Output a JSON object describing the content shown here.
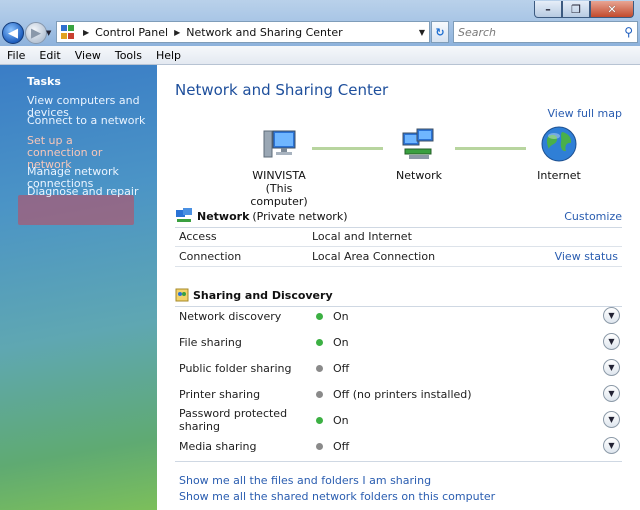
{
  "window": {
    "breadcrumbs": [
      "Control Panel",
      "Network and Sharing Center"
    ],
    "search_placeholder": "Search",
    "controls": {
      "minimize": "–",
      "maximize": "❐",
      "close": "✕"
    }
  },
  "menu": [
    "File",
    "Edit",
    "View",
    "Tools",
    "Help"
  ],
  "sidebar": {
    "title": "Tasks",
    "links": [
      "View computers and devices",
      "Connect to a network",
      "Set up a connection or network",
      "Manage network connections",
      "Diagnose and repair"
    ]
  },
  "main": {
    "title": "Network and Sharing Center",
    "view_full_map": "View full map",
    "map": {
      "computer_name": "WINVISTA",
      "computer_sub": "(This computer)",
      "network": "Network",
      "internet": "Internet"
    },
    "network_section": {
      "name": "Network",
      "type": "(Private network)",
      "customize": "Customize",
      "rows": [
        {
          "label": "Access",
          "value": "Local and Internet",
          "action": ""
        },
        {
          "label": "Connection",
          "value": "Local Area Connection",
          "action": "View status"
        }
      ]
    },
    "sharing": {
      "title": "Sharing and Discovery",
      "rows": [
        {
          "label": "Network discovery",
          "status": "On",
          "on": true
        },
        {
          "label": "File sharing",
          "status": "On",
          "on": true
        },
        {
          "label": "Public folder sharing",
          "status": "Off",
          "on": false
        },
        {
          "label": "Printer sharing",
          "status": "Off (no printers installed)",
          "on": false
        },
        {
          "label": "Password protected sharing",
          "status": "On",
          "on": true
        },
        {
          "label": "Media sharing",
          "status": "Off",
          "on": false
        }
      ]
    },
    "footer_links": [
      "Show me all the files and folders I am sharing",
      "Show me all the shared network folders on this computer"
    ]
  },
  "colors": {
    "on": "#3cb043",
    "off": "#8a8a8a",
    "accent": "#1e4f9c",
    "link": "#2a5db0"
  }
}
